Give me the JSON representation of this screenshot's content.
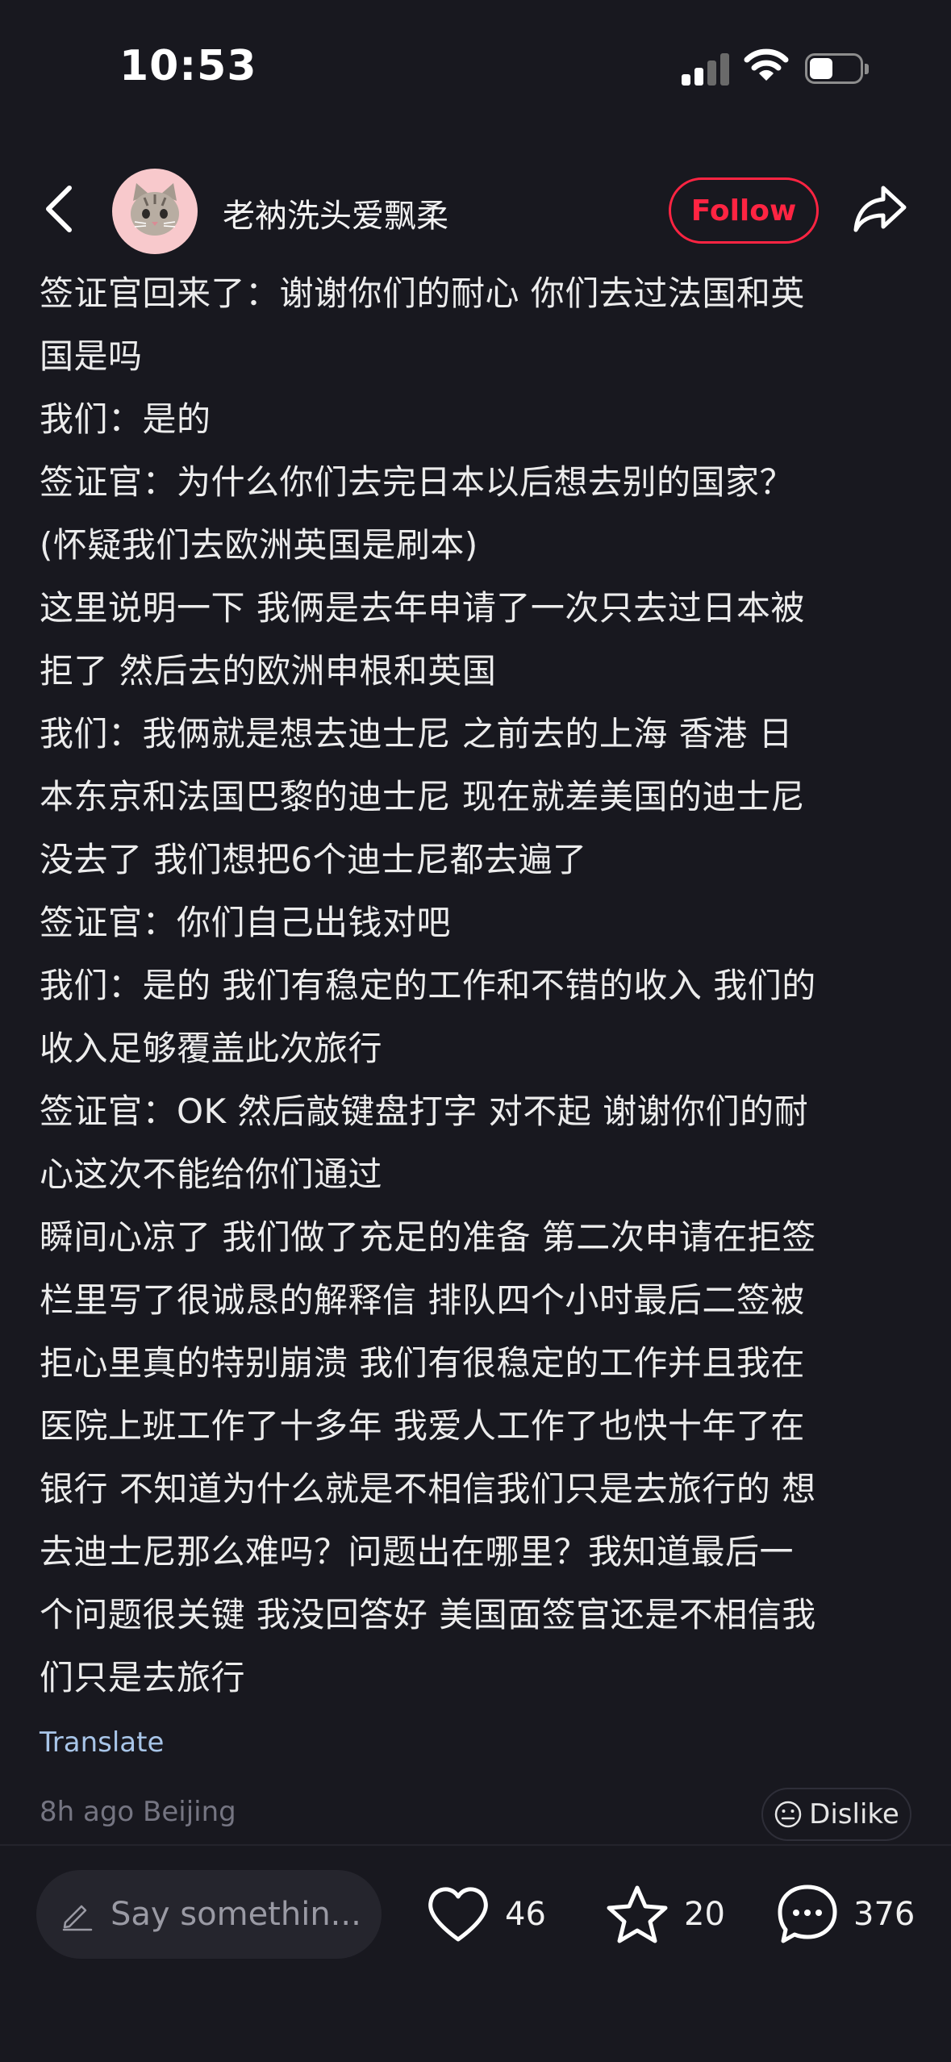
{
  "status_bar": {
    "time": "10:53",
    "battery_level": 0.42
  },
  "header": {
    "author_name": "老衲洗头爱飘柔",
    "follow_label": "Follow",
    "avatar_icon": "cat-face-icon"
  },
  "post": {
    "lines": [
      "签证官回来了：谢谢你们的耐心 你们去过法国和英",
      "国是吗",
      "我们：是的",
      "签证官：为什么你们去完日本以后想去别的国家？",
      "(怀疑我们去欧洲英国是刷本)",
      "这里说明一下 我俩是去年申请了一次只去过日本被",
      "拒了 然后去的欧洲申根和英国",
      "我们：我俩就是想去迪士尼 之前去的上海 香港 日",
      "本东京和法国巴黎的迪士尼 现在就差美国的迪士尼",
      "没去了 我们想把6个迪士尼都去遍了",
      "签证官：你们自己出钱对吧",
      "我们：是的 我们有稳定的工作和不错的收入 我们的",
      "收入足够覆盖此次旅行",
      "签证官：OK 然后敲键盘打字 对不起 谢谢你们的耐",
      "心这次不能给你们通过",
      "瞬间心凉了 我们做了充足的准备 第二次申请在拒签",
      "栏里写了很诚恳的解释信 排队四个小时最后二签被",
      "拒心里真的特别崩溃 我们有很稳定的工作并且我在",
      "医院上班工作了十多年 我爱人工作了也快十年了在",
      "银行 不知道为什么就是不相信我们只是去旅行的 想",
      "去迪士尼那么难吗？问题出在哪里？我知道最后一",
      "个问题很关键 我没回答好 美国面签官还是不相信我",
      "们只是去旅行"
    ],
    "translate_label": "Translate",
    "meta": "8h ago Beijing",
    "dislike_label": "Dislike"
  },
  "bottom_bar": {
    "comment_placeholder": "Say somethin...",
    "likes": "46",
    "collects": "20",
    "comments": "376"
  },
  "colors": {
    "accent": "#ff2442",
    "background": "#18181f",
    "link": "#a8c5e8"
  }
}
